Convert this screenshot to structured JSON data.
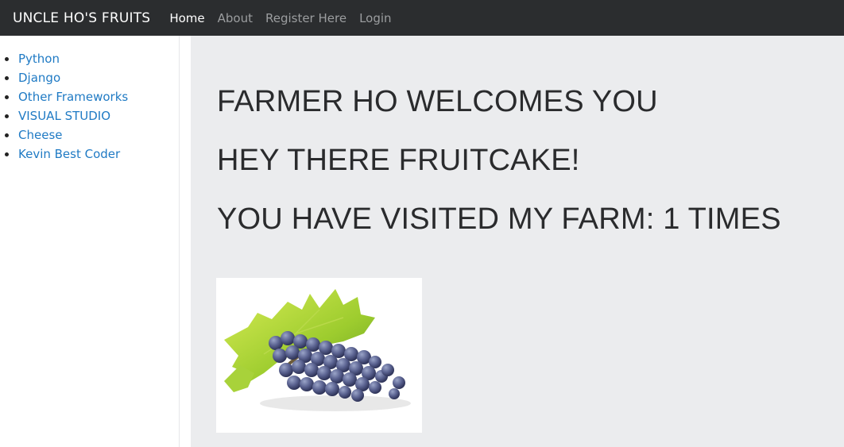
{
  "navbar": {
    "brand": "UNCLE HO'S FRUITS",
    "links": [
      {
        "label": "Home",
        "active": true
      },
      {
        "label": "About",
        "active": false
      },
      {
        "label": "Register Here",
        "active": false
      },
      {
        "label": "Login",
        "active": false
      }
    ]
  },
  "sidebar": {
    "items": [
      {
        "label": "Python"
      },
      {
        "label": "Django"
      },
      {
        "label": "Other Frameworks"
      },
      {
        "label": "VISUAL STUDIO"
      },
      {
        "label": "Cheese"
      },
      {
        "label": "Kevin Best Coder"
      }
    ]
  },
  "main": {
    "headings": [
      "FARMER HO WELCOMES YOU",
      "HEY THERE FRUITCAKE!",
      "YOU HAVE VISITED MY FARM: 1 TIMES"
    ],
    "image": {
      "subject": "grapes-with-leaves"
    }
  },
  "colors": {
    "navbar_bg": "#2b2d2f",
    "link_blue": "#1f7ac4",
    "main_bg": "#ebecee",
    "heading_text": "#2a2b2d"
  }
}
